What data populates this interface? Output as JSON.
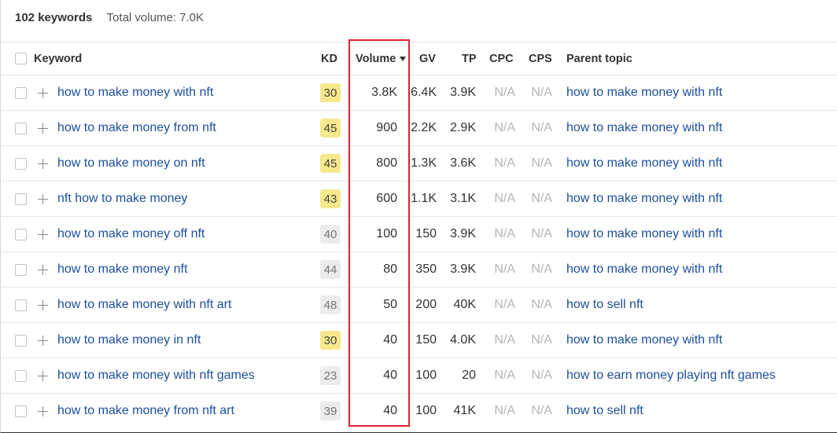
{
  "summary": {
    "keywords_count": "102 keywords",
    "total_volume": "Total volume: 7.0K"
  },
  "headers": {
    "keyword": "Keyword",
    "kd": "KD",
    "volume": "Volume",
    "gv": "GV",
    "tp": "TP",
    "cpc": "CPC",
    "cps": "CPS",
    "parent": "Parent topic"
  },
  "colors": {
    "kd_yellow": "#f6e98c",
    "kd_gray": "#ececec",
    "link": "#1c4f9c",
    "highlight": "#d9232e"
  },
  "rows": [
    {
      "keyword": "how to make money with nft",
      "kd": "30",
      "kd_color": "yellow",
      "volume": "3.8K",
      "gv": "6.4K",
      "tp": "3.9K",
      "cpc": "N/A",
      "cps": "N/A",
      "parent": "how to make money with nft"
    },
    {
      "keyword": "how to make money from nft",
      "kd": "45",
      "kd_color": "yellow",
      "volume": "900",
      "gv": "2.2K",
      "tp": "2.9K",
      "cpc": "N/A",
      "cps": "N/A",
      "parent": "how to make money with nft"
    },
    {
      "keyword": "how to make money on nft",
      "kd": "45",
      "kd_color": "yellow",
      "volume": "800",
      "gv": "1.3K",
      "tp": "3.6K",
      "cpc": "N/A",
      "cps": "N/A",
      "parent": "how to make money with nft"
    },
    {
      "keyword": "nft how to make money",
      "kd": "43",
      "kd_color": "yellow",
      "volume": "600",
      "gv": "1.1K",
      "tp": "3.1K",
      "cpc": "N/A",
      "cps": "N/A",
      "parent": "how to make money with nft"
    },
    {
      "keyword": "how to make money off nft",
      "kd": "40",
      "kd_color": "gray",
      "volume": "100",
      "gv": "150",
      "tp": "3.9K",
      "cpc": "N/A",
      "cps": "N/A",
      "parent": "how to make money with nft"
    },
    {
      "keyword": "how to make money nft",
      "kd": "44",
      "kd_color": "gray",
      "volume": "80",
      "gv": "350",
      "tp": "3.9K",
      "cpc": "N/A",
      "cps": "N/A",
      "parent": "how to make money with nft"
    },
    {
      "keyword": "how to make money with nft art",
      "kd": "48",
      "kd_color": "gray",
      "volume": "50",
      "gv": "200",
      "tp": "40K",
      "cpc": "N/A",
      "cps": "N/A",
      "parent": "how to sell nft"
    },
    {
      "keyword": "how to make money in nft",
      "kd": "30",
      "kd_color": "yellow",
      "volume": "40",
      "gv": "150",
      "tp": "4.0K",
      "cpc": "N/A",
      "cps": "N/A",
      "parent": "how to make money with nft"
    },
    {
      "keyword": "how to make money with nft games",
      "kd": "23",
      "kd_color": "gray",
      "volume": "40",
      "gv": "100",
      "tp": "20",
      "cpc": "N/A",
      "cps": "N/A",
      "parent": "how to earn money playing nft games"
    },
    {
      "keyword": "how to make money from nft art",
      "kd": "39",
      "kd_color": "gray",
      "volume": "40",
      "gv": "100",
      "tp": "41K",
      "cpc": "N/A",
      "cps": "N/A",
      "parent": "how to sell nft"
    }
  ]
}
